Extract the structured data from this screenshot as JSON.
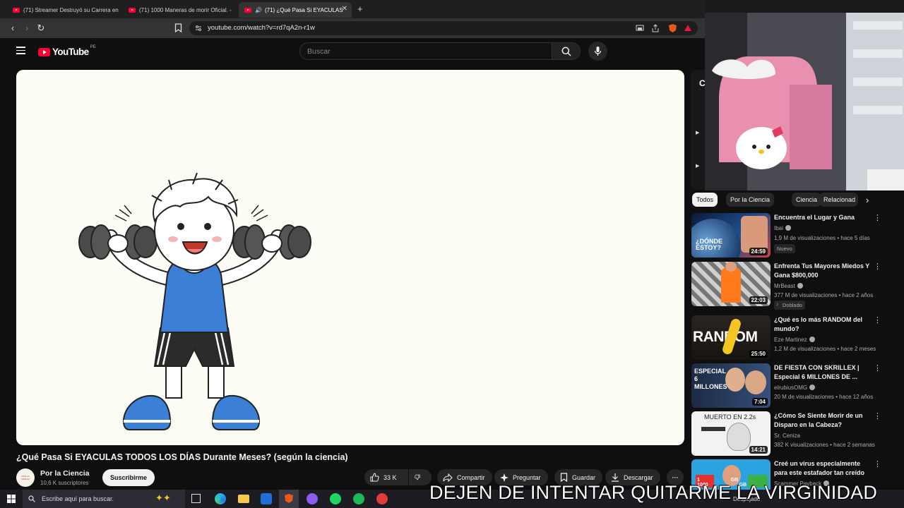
{
  "browser": {
    "tabs": [
      {
        "label": "(71) Streamer Destruyó su Carrera en"
      },
      {
        "label": "(71) 1000 Maneras de morir Oficial. -"
      },
      {
        "label": "(71) ¿Qué Pasa Si EYACULAS"
      }
    ],
    "new_tab": "+",
    "url": "youtube.com/watch?v=rd7qA2n-r1w"
  },
  "youtube": {
    "logo_text": "YouTube",
    "country_code": "PE",
    "search_placeholder": "Buscar"
  },
  "video": {
    "title": "¿Qué Pasa Si EYACULAS TODOS LOS DÍAS Durante Meses? (según la ciencia)",
    "channel": "Por la Ciencia",
    "subscribers": "10,6 K suscriptores",
    "avatar_text": "POR LA CIENCIA",
    "subscribe_label": "Suscribirme",
    "likes": "33 K",
    "share_label": "Compartir",
    "ask_label": "Preguntar",
    "save_label": "Guardar",
    "download_label": "Descargar",
    "more_label": "···"
  },
  "sidebar": {
    "partial_title": "C",
    "chips": [
      "Todos",
      "Por la Ciencia",
      "Ciencia",
      "Relacionad"
    ],
    "recommendations": [
      {
        "title": "Encuentra el Lugar y Gana",
        "channel": "Ibai",
        "verified": true,
        "meta": "1,9 M de visualizaciones • hace 5 días",
        "badge": "Nuevo",
        "duration": "24:59",
        "thumb_text": "¿DÓNDE ESTOY?"
      },
      {
        "title": "Enfrenta Tus Mayores Miedos Y Gana $800,000",
        "channel": "MrBeast",
        "verified": true,
        "meta": "377 M de visualizaciones • hace 2 años",
        "badge": "Doblado",
        "duration": "22:03",
        "thumb_text": ""
      },
      {
        "title": "¿Qué es lo más RANDOM del mundo?",
        "channel": "Eze Martinez",
        "verified": true,
        "meta": "1,2 M de visualizaciones • hace 2 meses",
        "badge": "",
        "duration": "25:50",
        "thumb_text": "RANDOM"
      },
      {
        "title": "DE FIESTA CON SKRILLEX | Especial 6 MILLONES DE ...",
        "channel": "elrubiusOMG",
        "verified": true,
        "meta": "20 M de visualizaciones • hace 12 años",
        "badge": "",
        "duration": "7:04",
        "thumb_text": "ESPECIAL 6 MILLONES"
      },
      {
        "title": "¿Cómo Se Siente Morir de un Disparo en la Cabeza?",
        "channel": "Sr. Ceniza",
        "verified": false,
        "meta": "382 K visualizaciones • hace 2 semanas",
        "badge": "",
        "duration": "14:21",
        "thumb_text": "MUERTO EN 2.2s"
      },
      {
        "title": "Creé un virus especialmente para este estafador tan creído",
        "channel": "Scammer Payback",
        "verified": true,
        "meta": "",
        "badge": "",
        "duration": "",
        "thumb_text": "1 GB 1000 GB"
      }
    ]
  },
  "taskbar": {
    "search_placeholder": "Escribe aquí para buscar.",
    "weather": "Despejado"
  },
  "overlay_text": "DEJEN DE INTENTAR QUITARME LA VIRGINIDAD",
  "colors": {
    "background": "#0f0f0f",
    "youtube_red": "#ff0033",
    "player_bg": "#fcfcf5",
    "shirt_blue": "#3b7fd6"
  }
}
